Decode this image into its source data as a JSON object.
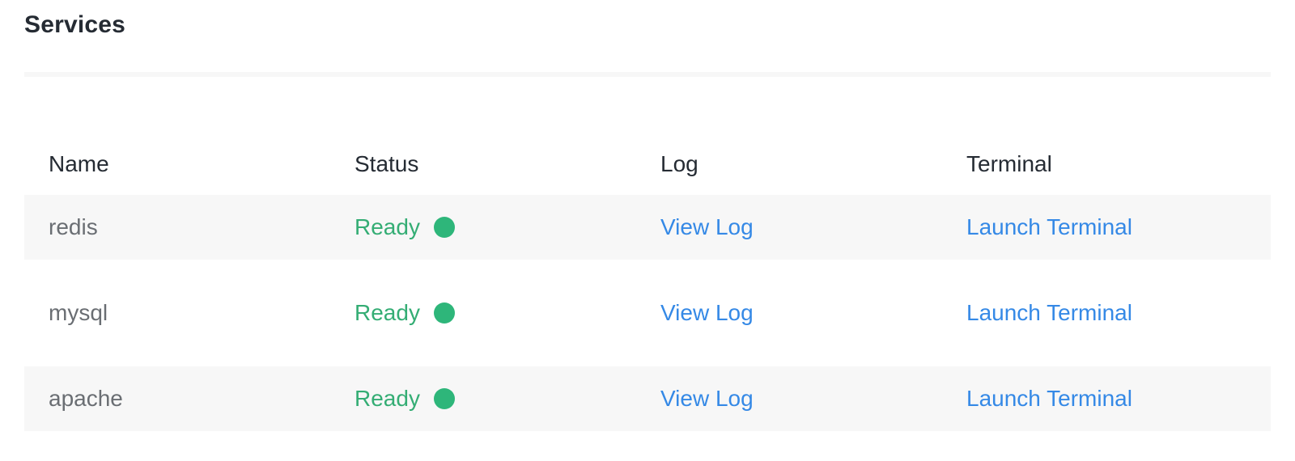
{
  "page": {
    "title": "Services"
  },
  "colors": {
    "ready": "#34ad74",
    "link": "#3589e6",
    "row_stripe": "#f7f7f7"
  },
  "table": {
    "columns": [
      "Name",
      "Status",
      "Log",
      "Terminal"
    ],
    "rows": [
      {
        "name": "redis",
        "status": "Ready",
        "status_icon": "status-dot-icon",
        "log": "View Log",
        "terminal": "Launch Terminal"
      },
      {
        "name": "mysql",
        "status": "Ready",
        "status_icon": "status-dot-icon",
        "log": "View Log",
        "terminal": "Launch Terminal"
      },
      {
        "name": "apache",
        "status": "Ready",
        "status_icon": "status-dot-icon",
        "log": "View Log",
        "terminal": "Launch Terminal"
      }
    ]
  }
}
